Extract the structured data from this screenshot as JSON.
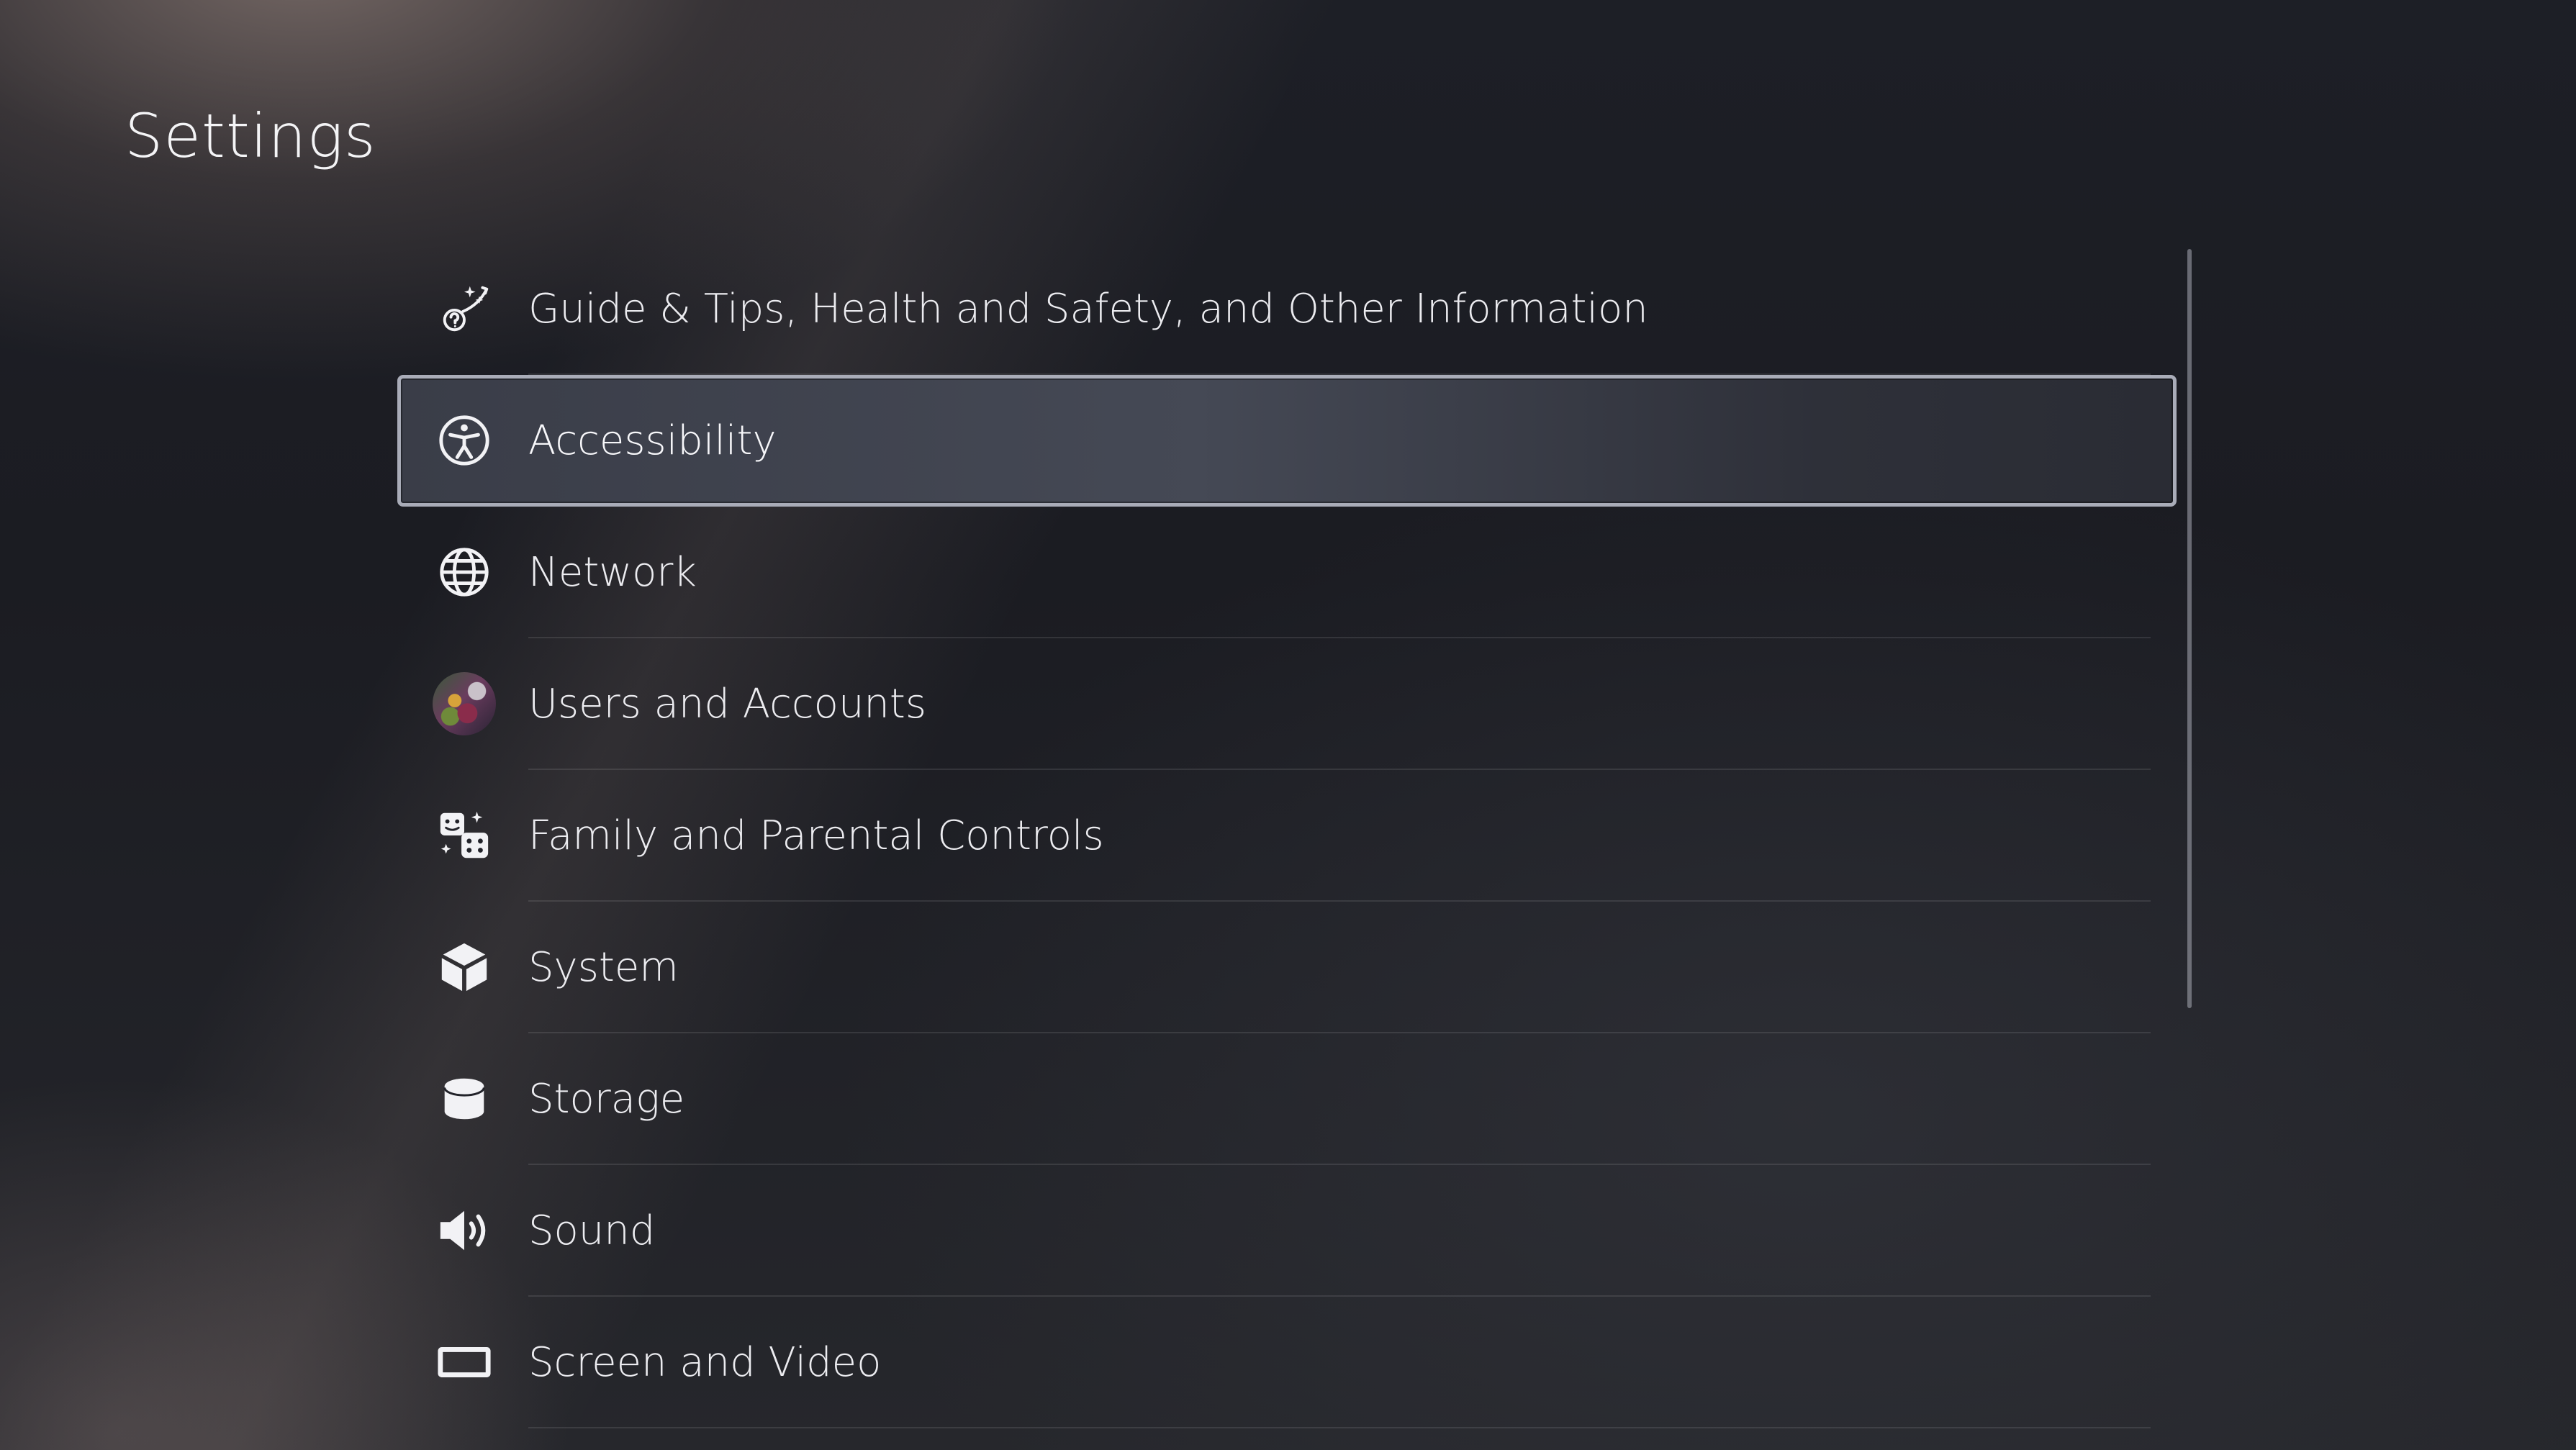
{
  "page": {
    "title": "Settings"
  },
  "menu": {
    "items": [
      {
        "label": "Guide & Tips, Health and Safety, and Other Information",
        "icon": "guide-tips-icon"
      },
      {
        "label": "Accessibility",
        "icon": "accessibility-icon",
        "selected": true
      },
      {
        "label": "Network",
        "icon": "globe-icon"
      },
      {
        "label": "Users and Accounts",
        "icon": "user-avatar"
      },
      {
        "label": "Family and Parental Controls",
        "icon": "family-controls-icon"
      },
      {
        "label": "System",
        "icon": "cube-icon"
      },
      {
        "label": "Storage",
        "icon": "cylinder-icon"
      },
      {
        "label": "Sound",
        "icon": "speaker-icon"
      },
      {
        "label": "Screen and Video",
        "icon": "screen-icon"
      }
    ]
  },
  "colors": {
    "selection_border": "#a9acb8",
    "text": "#ececf0",
    "background": "#1b1c22"
  }
}
